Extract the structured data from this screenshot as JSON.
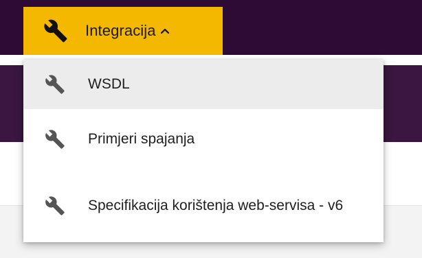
{
  "nav": {
    "tab_label": "Integracija",
    "tab_icon": "wrench-icon",
    "caret_icon": "chevron-up-icon",
    "tab_color": "#f5b800",
    "bar_color": "#2e0b34"
  },
  "dropdown": {
    "items": [
      {
        "label": "WSDL",
        "icon": "wrench-icon",
        "highlighted": true
      },
      {
        "label": "Primjeri spajanja",
        "icon": "wrench-icon",
        "highlighted": false
      },
      {
        "label": "Specifikacija korištenja web-servisa - v6",
        "icon": "wrench-icon",
        "highlighted": false
      }
    ]
  }
}
